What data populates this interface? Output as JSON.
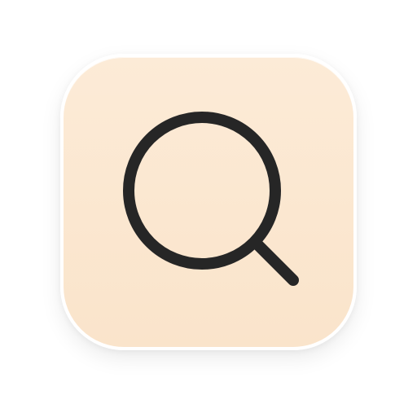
{
  "app_icon": {
    "icon_name": "search-icon",
    "background_color": "#fbe8d1",
    "border_color": "#ffffff",
    "glyph_color": "#262626"
  }
}
